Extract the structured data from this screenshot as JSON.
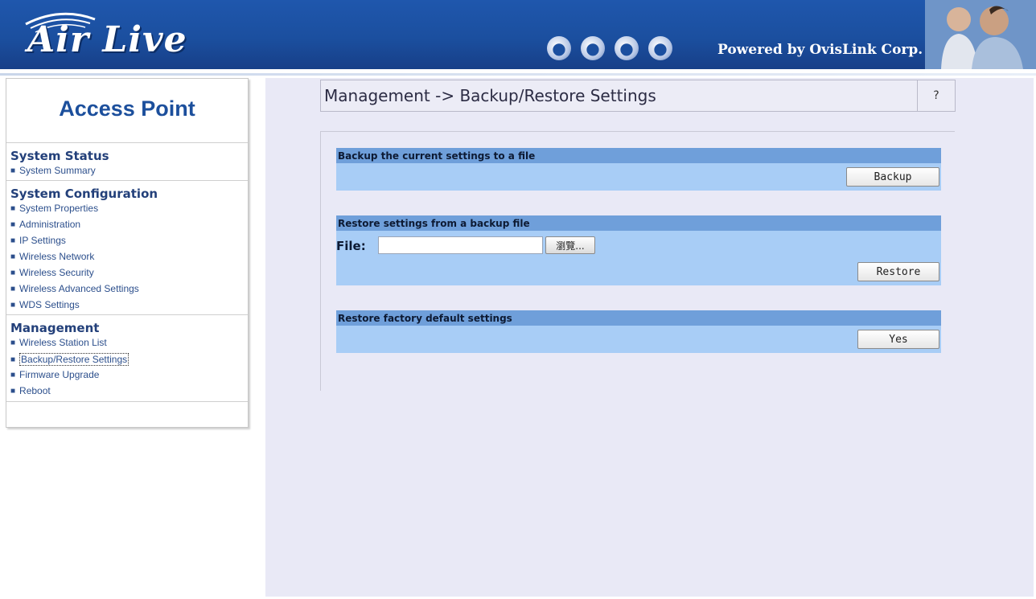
{
  "header": {
    "brand": "Air Live",
    "powered_by": "Powered by OvisLink Corp.",
    "globe_icons": [
      "globe-americas-icon",
      "globe-africa-icon",
      "globe-asia-icon",
      "globe-pacific-icon"
    ],
    "colors": {
      "banner": "#1b4f9f"
    }
  },
  "sidebar": {
    "title": "Access Point",
    "sections": [
      {
        "heading": "System Status",
        "items": [
          "System Summary"
        ]
      },
      {
        "heading": "System Configuration",
        "items": [
          "System Properties",
          "Administration",
          "IP Settings",
          "Wireless Network",
          "Wireless Security",
          "Wireless Advanced Settings",
          "WDS Settings"
        ]
      },
      {
        "heading": "Management",
        "items": [
          "Wireless Station List",
          "Backup/Restore Settings",
          "Firmware Upgrade",
          "Reboot"
        ]
      }
    ],
    "active_item": "Backup/Restore Settings"
  },
  "page": {
    "title": "Management -> Backup/Restore Settings",
    "help": "?",
    "backup": {
      "heading": "Backup the current settings to a file",
      "button": "Backup"
    },
    "restore": {
      "heading": "Restore settings from a backup file",
      "file_label": "File:",
      "file_value": "",
      "browse": "瀏覽...",
      "button": "Restore"
    },
    "factory": {
      "heading": "Restore factory default settings",
      "button": "Yes"
    },
    "colors": {
      "section_header": "#6f9fda",
      "section_body": "#a8cdf6",
      "page_bg": "#e9e9f6"
    }
  }
}
